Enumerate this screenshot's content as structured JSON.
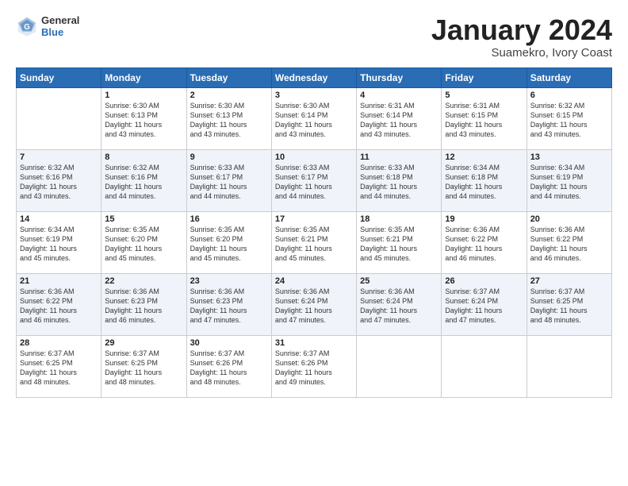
{
  "logo": {
    "general": "General",
    "blue": "Blue"
  },
  "title": "January 2024",
  "subtitle": "Suamekro, Ivory Coast",
  "header_days": [
    "Sunday",
    "Monday",
    "Tuesday",
    "Wednesday",
    "Thursday",
    "Friday",
    "Saturday"
  ],
  "weeks": [
    [
      {
        "day": "",
        "info": ""
      },
      {
        "day": "1",
        "info": "Sunrise: 6:30 AM\nSunset: 6:13 PM\nDaylight: 11 hours\nand 43 minutes."
      },
      {
        "day": "2",
        "info": "Sunrise: 6:30 AM\nSunset: 6:13 PM\nDaylight: 11 hours\nand 43 minutes."
      },
      {
        "day": "3",
        "info": "Sunrise: 6:30 AM\nSunset: 6:14 PM\nDaylight: 11 hours\nand 43 minutes."
      },
      {
        "day": "4",
        "info": "Sunrise: 6:31 AM\nSunset: 6:14 PM\nDaylight: 11 hours\nand 43 minutes."
      },
      {
        "day": "5",
        "info": "Sunrise: 6:31 AM\nSunset: 6:15 PM\nDaylight: 11 hours\nand 43 minutes."
      },
      {
        "day": "6",
        "info": "Sunrise: 6:32 AM\nSunset: 6:15 PM\nDaylight: 11 hours\nand 43 minutes."
      }
    ],
    [
      {
        "day": "7",
        "info": "Sunrise: 6:32 AM\nSunset: 6:16 PM\nDaylight: 11 hours\nand 43 minutes."
      },
      {
        "day": "8",
        "info": "Sunrise: 6:32 AM\nSunset: 6:16 PM\nDaylight: 11 hours\nand 44 minutes."
      },
      {
        "day": "9",
        "info": "Sunrise: 6:33 AM\nSunset: 6:17 PM\nDaylight: 11 hours\nand 44 minutes."
      },
      {
        "day": "10",
        "info": "Sunrise: 6:33 AM\nSunset: 6:17 PM\nDaylight: 11 hours\nand 44 minutes."
      },
      {
        "day": "11",
        "info": "Sunrise: 6:33 AM\nSunset: 6:18 PM\nDaylight: 11 hours\nand 44 minutes."
      },
      {
        "day": "12",
        "info": "Sunrise: 6:34 AM\nSunset: 6:18 PM\nDaylight: 11 hours\nand 44 minutes."
      },
      {
        "day": "13",
        "info": "Sunrise: 6:34 AM\nSunset: 6:19 PM\nDaylight: 11 hours\nand 44 minutes."
      }
    ],
    [
      {
        "day": "14",
        "info": "Sunrise: 6:34 AM\nSunset: 6:19 PM\nDaylight: 11 hours\nand 45 minutes."
      },
      {
        "day": "15",
        "info": "Sunrise: 6:35 AM\nSunset: 6:20 PM\nDaylight: 11 hours\nand 45 minutes."
      },
      {
        "day": "16",
        "info": "Sunrise: 6:35 AM\nSunset: 6:20 PM\nDaylight: 11 hours\nand 45 minutes."
      },
      {
        "day": "17",
        "info": "Sunrise: 6:35 AM\nSunset: 6:21 PM\nDaylight: 11 hours\nand 45 minutes."
      },
      {
        "day": "18",
        "info": "Sunrise: 6:35 AM\nSunset: 6:21 PM\nDaylight: 11 hours\nand 45 minutes."
      },
      {
        "day": "19",
        "info": "Sunrise: 6:36 AM\nSunset: 6:22 PM\nDaylight: 11 hours\nand 46 minutes."
      },
      {
        "day": "20",
        "info": "Sunrise: 6:36 AM\nSunset: 6:22 PM\nDaylight: 11 hours\nand 46 minutes."
      }
    ],
    [
      {
        "day": "21",
        "info": "Sunrise: 6:36 AM\nSunset: 6:22 PM\nDaylight: 11 hours\nand 46 minutes."
      },
      {
        "day": "22",
        "info": "Sunrise: 6:36 AM\nSunset: 6:23 PM\nDaylight: 11 hours\nand 46 minutes."
      },
      {
        "day": "23",
        "info": "Sunrise: 6:36 AM\nSunset: 6:23 PM\nDaylight: 11 hours\nand 47 minutes."
      },
      {
        "day": "24",
        "info": "Sunrise: 6:36 AM\nSunset: 6:24 PM\nDaylight: 11 hours\nand 47 minutes."
      },
      {
        "day": "25",
        "info": "Sunrise: 6:36 AM\nSunset: 6:24 PM\nDaylight: 11 hours\nand 47 minutes."
      },
      {
        "day": "26",
        "info": "Sunrise: 6:37 AM\nSunset: 6:24 PM\nDaylight: 11 hours\nand 47 minutes."
      },
      {
        "day": "27",
        "info": "Sunrise: 6:37 AM\nSunset: 6:25 PM\nDaylight: 11 hours\nand 48 minutes."
      }
    ],
    [
      {
        "day": "28",
        "info": "Sunrise: 6:37 AM\nSunset: 6:25 PM\nDaylight: 11 hours\nand 48 minutes."
      },
      {
        "day": "29",
        "info": "Sunrise: 6:37 AM\nSunset: 6:25 PM\nDaylight: 11 hours\nand 48 minutes."
      },
      {
        "day": "30",
        "info": "Sunrise: 6:37 AM\nSunset: 6:26 PM\nDaylight: 11 hours\nand 48 minutes."
      },
      {
        "day": "31",
        "info": "Sunrise: 6:37 AM\nSunset: 6:26 PM\nDaylight: 11 hours\nand 49 minutes."
      },
      {
        "day": "",
        "info": ""
      },
      {
        "day": "",
        "info": ""
      },
      {
        "day": "",
        "info": ""
      }
    ]
  ]
}
